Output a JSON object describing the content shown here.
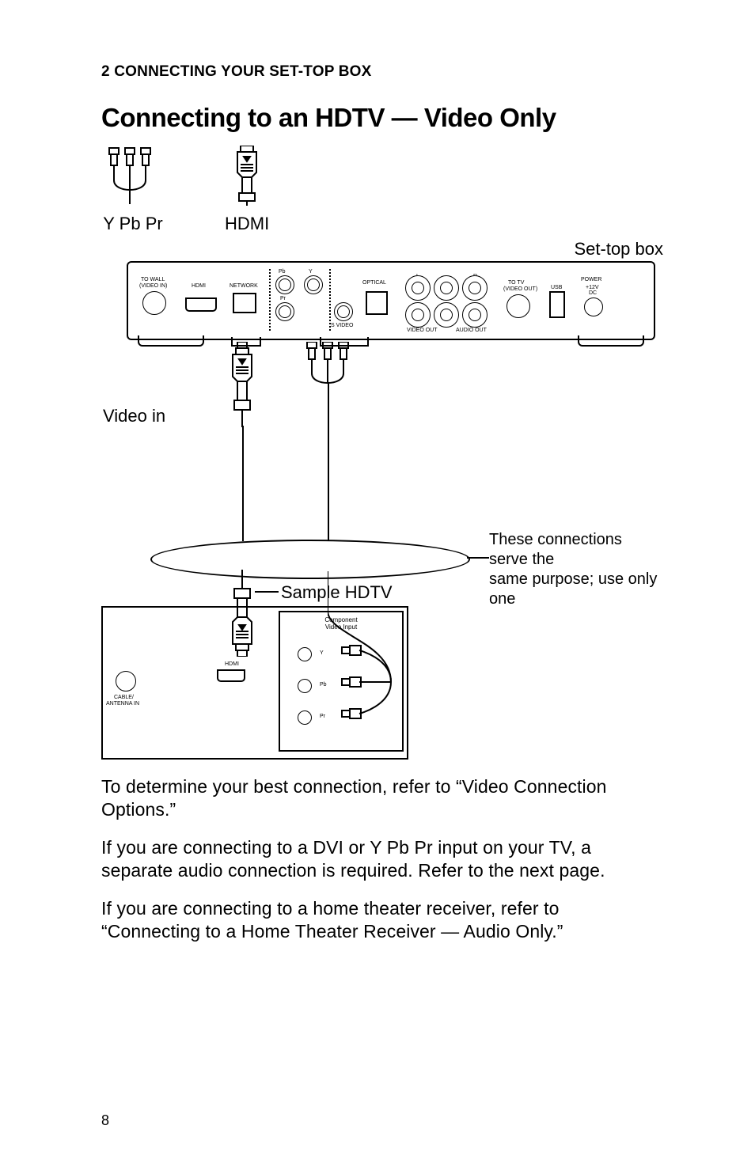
{
  "section_label": "2 CONNECTING YOUR SET-TOP BOX",
  "section_title": "Connecting to an HDTV — Video Only",
  "cables": {
    "ypbpr_caption": "Y Pb Pr",
    "hdmi_caption": "HDMI"
  },
  "diagram": {
    "stb_label": "Set-top box",
    "video_in_label": "Video in",
    "ellipse_note_line1": "These connections serve the",
    "ellipse_note_line2": "same purpose; use only one",
    "hdtv_label": "Sample HDTV",
    "stb_ports": {
      "to_wall_l1": "TO WALL",
      "to_wall_l2": "(VIDEO IN)",
      "hdmi": "HDMI",
      "network": "NETWORK",
      "pb": "Pb",
      "y": "Y",
      "pr": "Pr",
      "s_video": "S VIDEO",
      "optical": "OPTICAL",
      "lr_l": "L",
      "lr_r": "R",
      "video_out": "VIDEO OUT",
      "audio_out": "AUDIO OUT",
      "to_tv_l1": "TO TV",
      "to_tv_l2": "(VIDEO OUT)",
      "usb": "USB",
      "power": "POWER",
      "dc_l1": "+12V",
      "dc_l2": "DC"
    },
    "tv_ports": {
      "cable_antenna_l1": "CABLE/",
      "cable_antenna_l2": "ANTENNA IN",
      "hdmi": "HDMI",
      "component_l1": "Component",
      "component_l2": "Video Input",
      "y": "Y",
      "pb": "Pb",
      "pr": "Pr"
    }
  },
  "paragraphs": {
    "p1": "To determine your best connection, refer to “Video Connection Options.”",
    "p2": "If you are connecting to a DVI or Y Pb Pr input on your TV, a separate audio connection is required. Refer to the next page.",
    "p3": "If you are connecting to a home theater receiver, refer to “Connecting to a Home Theater Receiver — Audio Only.”"
  },
  "page_number": "8"
}
